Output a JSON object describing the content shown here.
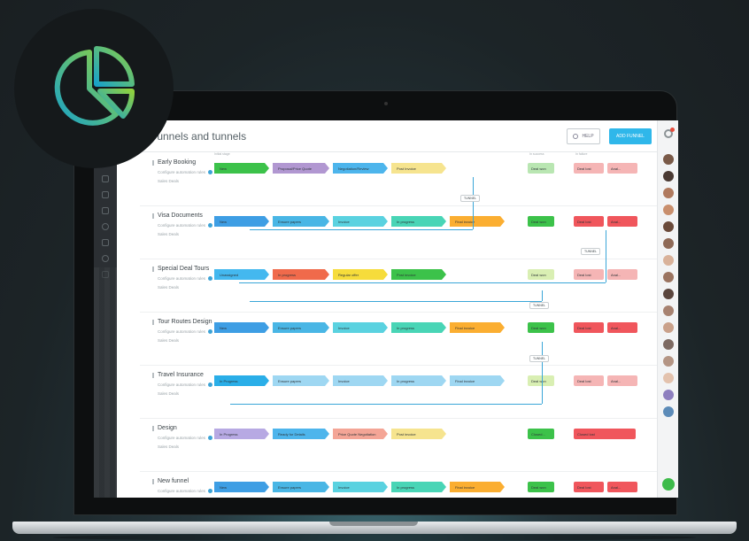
{
  "app": {
    "page_title": "Funnels and tunnels",
    "help_label": "HELP",
    "add_label": "ADD FUNNEL",
    "column_labels": [
      "Initial stage",
      "In success",
      "In failure"
    ]
  },
  "funnels": [
    {
      "name": "Early Booking",
      "sub": "Configure automation rules",
      "sub2": "Sales Deals",
      "stages": [
        {
          "label": "New",
          "color": "#3cc24a"
        },
        {
          "label": "Proposal/Price Quote",
          "color": "#b197d1"
        },
        {
          "label": "Negotiation/Review",
          "color": "#4db5ec"
        },
        {
          "label": "Post Invoice",
          "color": "#f6e48f"
        }
      ],
      "success": {
        "label": "Deal won",
        "color": "#b9e6b2"
      },
      "failure": [
        {
          "label": "Deal lost",
          "color": "#f5b5b5"
        },
        {
          "label": "Anal...",
          "color": "#f5b5b5"
        }
      ]
    },
    {
      "name": "Visa Documents",
      "sub": "Configure automation rules",
      "sub2": "Sales Deals",
      "stages": [
        {
          "label": "New",
          "color": "#3e9ee4"
        },
        {
          "label": "Ensure papers",
          "color": "#49b6e5"
        },
        {
          "label": "Invoice",
          "color": "#5ad2e0"
        },
        {
          "label": "In progress",
          "color": "#49d5b6"
        },
        {
          "label": "Final invoice",
          "color": "#fbae31"
        }
      ],
      "success": {
        "label": "Deal won",
        "color": "#3cc24a"
      },
      "failure": [
        {
          "label": "Deal lost",
          "color": "#f0565c"
        },
        {
          "label": "Anal...",
          "color": "#f0565c"
        }
      ]
    },
    {
      "name": "Special Deal Tours",
      "sub": "Configure automation rules",
      "sub2": "Sales Deals",
      "stages": [
        {
          "label": "Unassigned",
          "color": "#44b8ef"
        },
        {
          "label": "In progress",
          "color": "#f06a4b"
        },
        {
          "label": "Regular offer",
          "color": "#f6dc3b"
        },
        {
          "label": "Post invoice",
          "color": "#3cc24a"
        }
      ],
      "success": {
        "label": "Deal won",
        "color": "#d9efb3"
      },
      "failure": [
        {
          "label": "Deal lost",
          "color": "#f5b5b5"
        },
        {
          "label": "Anal...",
          "color": "#f5b5b5"
        }
      ]
    },
    {
      "name": "Tour Routes Design",
      "sub": "Configure automation rules",
      "sub2": "Sales Deals",
      "stages": [
        {
          "label": "New",
          "color": "#3e9ee4"
        },
        {
          "label": "Ensure papers",
          "color": "#49b6e5"
        },
        {
          "label": "Invoice",
          "color": "#5ad2e0"
        },
        {
          "label": "In progress",
          "color": "#49d5b6"
        },
        {
          "label": "Final invoice",
          "color": "#fbae31"
        }
      ],
      "success": {
        "label": "Deal won",
        "color": "#3cc24a"
      },
      "failure": [
        {
          "label": "Deal lost",
          "color": "#f0565c"
        },
        {
          "label": "Anal...",
          "color": "#f0565c"
        }
      ]
    },
    {
      "name": "Travel Insurance",
      "sub": "Configure automation rules",
      "sub2": "Sales Deals",
      "stages": [
        {
          "label": "In Progress",
          "color": "#2aaee8"
        },
        {
          "label": "Ensure papers",
          "color": "#9ed7f2"
        },
        {
          "label": "Invoice",
          "color": "#9ed7f2"
        },
        {
          "label": "In progress",
          "color": "#9ed7f2"
        },
        {
          "label": "Final invoice",
          "color": "#9ed7f2"
        }
      ],
      "success": {
        "label": "Deal won",
        "color": "#d9efb3"
      },
      "failure": [
        {
          "label": "Deal lost",
          "color": "#f5b5b5"
        },
        {
          "label": "Anal...",
          "color": "#f5b5b5"
        }
      ]
    },
    {
      "name": "Design",
      "sub": "Configure automation rules",
      "sub2": "Sales Deals",
      "stages": [
        {
          "label": "In Progress",
          "color": "#b7a9e3"
        },
        {
          "label": "Ready for Details",
          "color": "#4db5ec"
        },
        {
          "label": "Price Quote Negotiation",
          "color": "#f4a596"
        },
        {
          "label": "Post invoice",
          "color": "#f6e48f"
        }
      ],
      "success": {
        "label": "Closed...",
        "color": "#3cc24a"
      },
      "failure": [
        {
          "label": "Closed lost",
          "color": "#f0565c"
        }
      ]
    },
    {
      "name": "New funnel",
      "sub": "Configure automation rules",
      "sub2": "Sales Deals",
      "stages": [
        {
          "label": "New",
          "color": "#3e9ee4"
        },
        {
          "label": "Ensure papers",
          "color": "#49b6e5"
        },
        {
          "label": "Invoice",
          "color": "#5ad2e0"
        },
        {
          "label": "In progress",
          "color": "#49d5b6"
        },
        {
          "label": "Final invoice",
          "color": "#fbae31"
        }
      ],
      "success": {
        "label": "Deal won",
        "color": "#3cc24a"
      },
      "failure": [
        {
          "label": "Deal lost",
          "color": "#f0565c"
        },
        {
          "label": "Anal...",
          "color": "#f0565c"
        }
      ]
    }
  ],
  "tunnel_label": "TUNNEL",
  "avatars": [
    "#7a5a48",
    "#4a3a33",
    "#b07a5e",
    "#c98f6d",
    "#6b4b3b",
    "#8f6a57",
    "#d9b29a",
    "#9b7460",
    "#5b463e",
    "#a78270",
    "#caa18a",
    "#7d6a62",
    "#b49584",
    "#e3c2ad",
    "#8e7fbf",
    "#5c8bb8"
  ]
}
